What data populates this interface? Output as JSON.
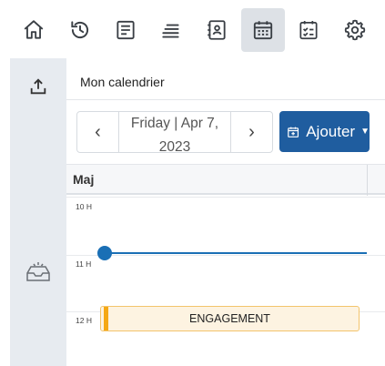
{
  "toolbar": {
    "items": [
      {
        "icon": "home-icon"
      },
      {
        "icon": "history-icon"
      },
      {
        "icon": "document-list-icon"
      },
      {
        "icon": "stack-list-icon"
      },
      {
        "icon": "contacts-book-icon"
      },
      {
        "icon": "calendar-icon",
        "active": true
      },
      {
        "icon": "checklist-calendar-icon"
      },
      {
        "icon": "gear-icon"
      }
    ]
  },
  "rail": {
    "items": [
      {
        "icon": "upload-icon"
      },
      {
        "icon": "inbox-tray-icon"
      }
    ]
  },
  "calendar": {
    "title": "Mon calendrier",
    "date_line1": "Friday | Apr 7,",
    "date_line2": "2023",
    "prev_glyph": "‹",
    "next_glyph": "›",
    "add_label": "Ajouter",
    "day_label": "Maj",
    "hours": [
      "10 H",
      "11 H",
      "12 H"
    ],
    "event_title": "ENGAGEMENT"
  },
  "colors": {
    "accent": "#1f5d9f",
    "now_line": "#1a6fb5",
    "event_bar": "#f5a814",
    "event_bg": "#fdf3e1"
  }
}
